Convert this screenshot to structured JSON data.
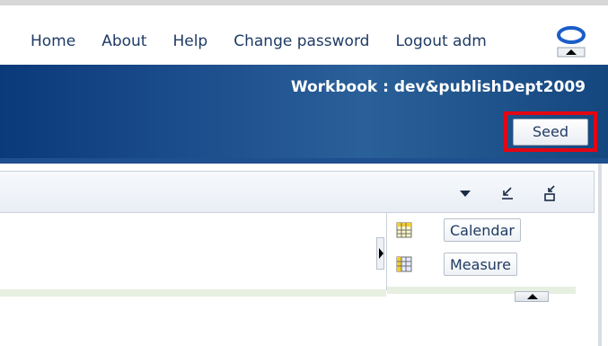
{
  "nav": {
    "home": "Home",
    "about": "About",
    "help": "Help",
    "change_password": "Change password",
    "logout": "Logout adm"
  },
  "header": {
    "workbook_label": "Workbook : dev&publishDept2009"
  },
  "toolbar": {
    "seed_label": "Seed"
  },
  "panel": {
    "items": [
      {
        "label": "Calendar",
        "icon": "grid-icon"
      },
      {
        "label": "Measure",
        "icon": "grid-icon"
      }
    ]
  },
  "colors": {
    "brand_blue": "#1e4f8e",
    "highlight_red": "#e30613",
    "nav_text": "#1f3b66"
  }
}
